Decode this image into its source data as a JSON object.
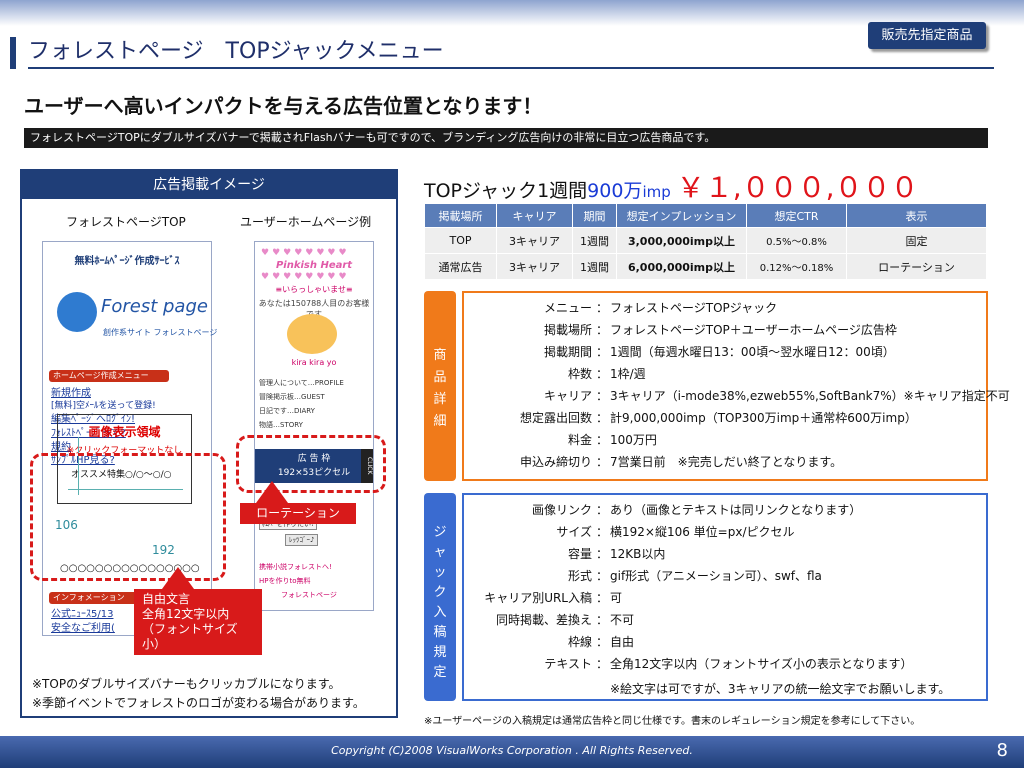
{
  "badge": "販売先指定商品",
  "title": "フォレストページ　TOPジャックメニュー",
  "headline": "ユーザーへ高いインパクトを与える広告位置となります！",
  "description": "フォレストページTOPにダブルサイズバナーで掲載されFlashバナーも可ですので、ブランディング広告向けの非常に目立つ広告商品です。",
  "left": {
    "header": "広告掲載イメージ",
    "col1": "フォレストページTOP",
    "col2": "ユーザーホームページ例",
    "phone1": {
      "service": "無料ﾎｰﾑﾍﾟｰｼﾞ作成ｻｰﾋﾞｽ",
      "logo": "Forest page",
      "logo_sub": "創作系サイト フォレストページ",
      "menu_bar": "ホームページ作成メニュー",
      "items": [
        "新規作成",
        "[無料]空ﾒｰﾙを送って登録!",
        "編集ﾍﾟｰｼﾞへﾛｸﾞｲﾝ!",
        "ﾌｫﾚｽﾄﾍﾟｰｼﾞって?",
        "規約",
        "ｻﾝﾌﾟﾙHP見る?"
      ],
      "feature": "オススメ特集○/○～○/○",
      "area_title": "画像表示領域",
      "area_sub": "※クリックフォーマットなし",
      "w": "192",
      "h": "106",
      "circles": "○○○○○○○○○○○○○○○○",
      "info_bar": "インフォメーション",
      "info_items": [
        "公式ﾆｭｰｽ5/13",
        "安全なご利用("
      ]
    },
    "phone2": {
      "hearts": "♥♥♥♥♥♥♥♥",
      "name": "Pinkish Heart",
      "welcome": "≡いらっしゃいませ≡",
      "line1": "あなたは150788人目のお客様です",
      "tag": "kira kira yo",
      "links": [
        "管理人について…PROFILE",
        "冒険掲示板…GUEST",
        "日記です…DIARY",
        "物語…STORY"
      ],
      "ad_title": "広 告 枠",
      "ad_size": "192×53ピクセル",
      "click": "CLICK",
      "form1": "ﾎﾑﾍﾟを作りたい!",
      "form2": "ﾚｯﾂｺﾞｰ♪",
      "bottom1": "携帯小説フォレストへ!",
      "bottom2": "HPを作りto無料",
      "bottom3": "フォレストページ"
    },
    "rotation_label": "ローテーション",
    "free_text": [
      "自由文言",
      "全角12文字以内",
      "（フォントサイズ小）"
    ],
    "notes": [
      "※TOPのダブルサイズバナーもクリッカブルになります。",
      "※季節イベントでフォレストのロゴが変わる場合があります。"
    ]
  },
  "right": {
    "title_main": "TOPジャック1週間",
    "title_imp_num": "900万",
    "title_imp": "imp",
    "price": "￥１,０００,０００",
    "table": {
      "headers": [
        "掲載場所",
        "キャリア",
        "期間",
        "想定インプレッション",
        "想定CTR",
        "表示"
      ],
      "rows": [
        [
          "TOP",
          "3キャリア",
          "1週間",
          "3,000,000imp以上",
          "0.5%～0.8%",
          "固定"
        ],
        [
          "通常広告",
          "3キャリア",
          "1週間",
          "6,000,000imp以上",
          "0.12%～0.18%",
          "ローテーション"
        ]
      ]
    },
    "product_tab": "商品詳細",
    "product": [
      {
        "k": "メニュー",
        "v": "フォレストページTOPジャック"
      },
      {
        "k": "掲載場所",
        "v": "フォレストページTOP＋ユーザーホームページ広告枠"
      },
      {
        "k": "掲載期間",
        "v": "1週間（毎週水曜日13：00頃～翌水曜日12：00頃）"
      },
      {
        "k": "枠数",
        "v": "1枠/週"
      },
      {
        "k": "キャリア",
        "v": "3キャリア（i-mode38%,ezweb55%,SoftBank7%）※キャリア指定不可"
      },
      {
        "k": "想定露出回数",
        "v": "計9,000,000imp（TOP300万imp＋通常枠600万imp）"
      },
      {
        "k": "料金",
        "v": "100万円"
      },
      {
        "k": "申込み締切り",
        "v": "7営業日前　※完売しだい終了となります。"
      }
    ],
    "jack_tab": "ジャック入稿規定",
    "jack": [
      {
        "k": "画像リンク",
        "v": "あり（画像とテキストは同リンクとなります）"
      },
      {
        "k": "サイズ",
        "v": "横192×縦106 単位=px/ピクセル"
      },
      {
        "k": "容量",
        "v": "12KB以内"
      },
      {
        "k": "形式",
        "v": "gif形式（アニメーション可）、swf、fla"
      },
      {
        "k": "キャリア別URL入稿",
        "v": "可"
      },
      {
        "k": "同時掲載、差換え",
        "v": "不可"
      },
      {
        "k": "枠線",
        "v": "自由"
      },
      {
        "k": "テキスト",
        "v": "全角12文字以内（フォントサイズ小の表示となります）"
      }
    ],
    "jack_extra": "※絵文字は可ですが、3キャリアの統一絵文字でお願いします。",
    "foot_note": "※ユーザーページの入稿規定は通常広告枠と同じ仕様です。書末のレギュレーション規定を参考にして下さい。"
  },
  "footer": {
    "copyright": "Copyright (C)2008  VisualWorks Corporation . All Rights Reserved.",
    "page": "8"
  }
}
